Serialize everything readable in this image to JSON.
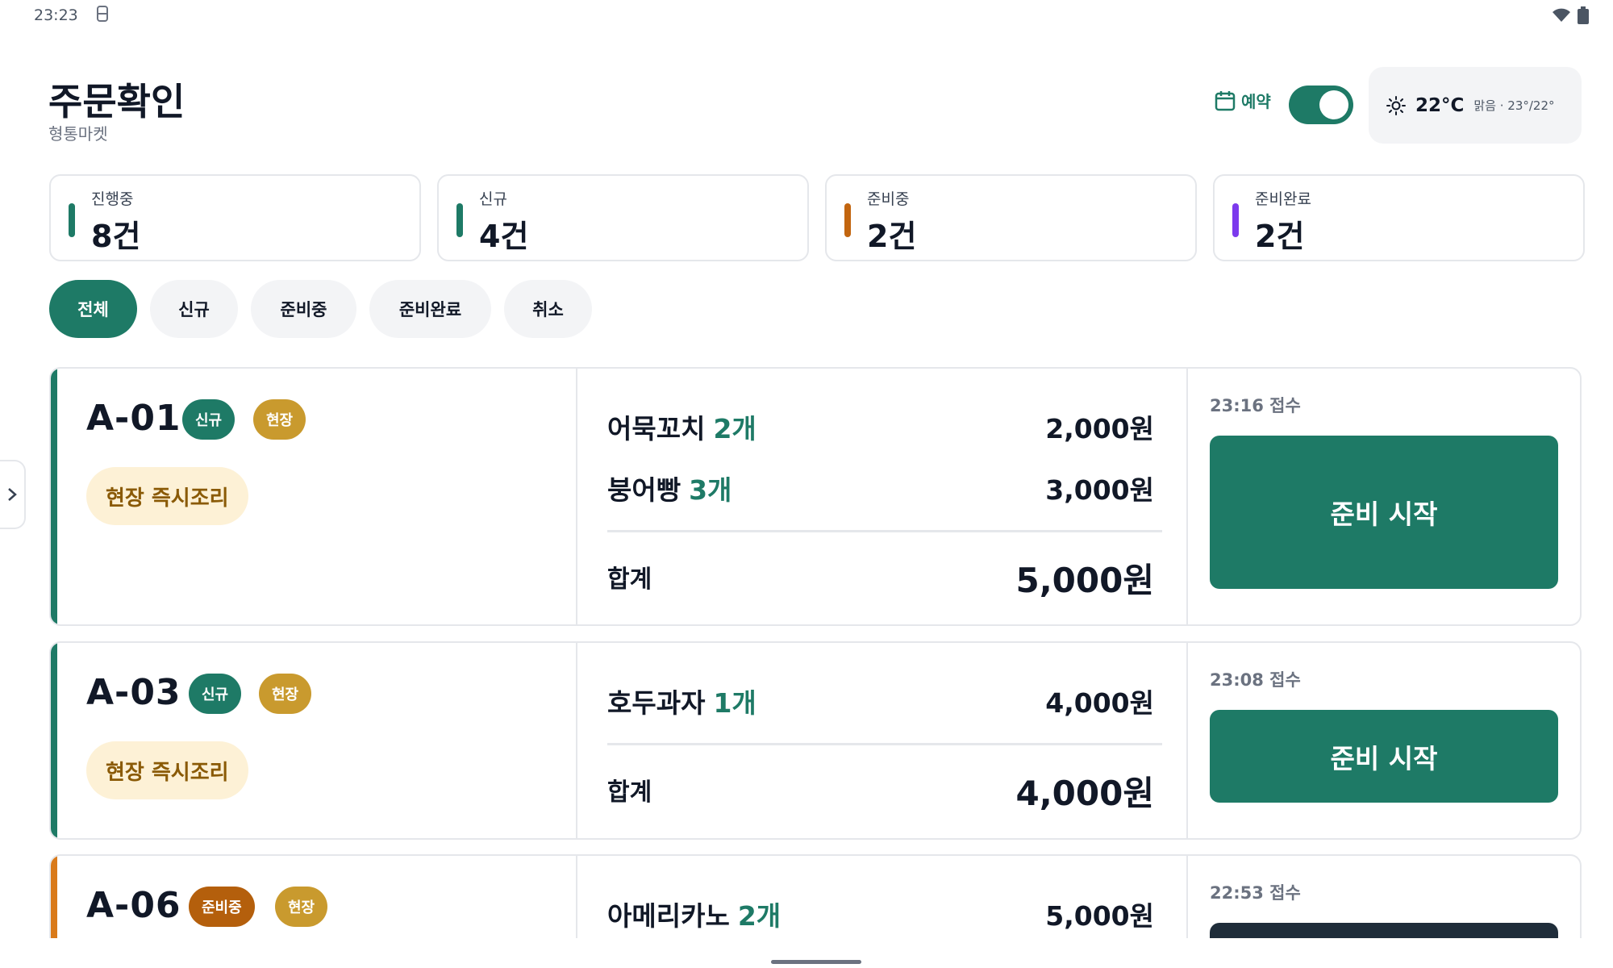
{
  "status_bar": {
    "time": "23:23"
  },
  "header": {
    "title": "주문확인",
    "subtitle": "형통마켓",
    "reserve_label": "예약",
    "reserve_on": true,
    "weather": {
      "temp": "22°C",
      "desc": "맑음 · 23°/22°"
    }
  },
  "summary": [
    {
      "label": "진행중",
      "value": "8건",
      "color": "#1e7a66"
    },
    {
      "label": "신규",
      "value": "4건",
      "color": "#1e7a66"
    },
    {
      "label": "준비중",
      "value": "2건",
      "color": "#c2650f"
    },
    {
      "label": "준비완료",
      "value": "2건",
      "color": "#7c3aed"
    }
  ],
  "tabs": [
    {
      "label": "전체",
      "active": true
    },
    {
      "label": "신규",
      "active": false
    },
    {
      "label": "준비중",
      "active": false
    },
    {
      "label": "준비완료",
      "active": false
    },
    {
      "label": "취소",
      "active": false
    }
  ],
  "orders": [
    {
      "no": "A-01",
      "status_badge": "신규",
      "type_badge": "현장",
      "note": "현장 즉시조리",
      "items": [
        {
          "name": "어묵꼬치",
          "qty": "2개",
          "price": "2,000원"
        },
        {
          "name": "붕어빵",
          "qty": "3개",
          "price": "3,000원"
        }
      ],
      "sum_label": "합계",
      "sum": "5,000원",
      "received": "23:16 접수",
      "action": "준비 시작"
    },
    {
      "no": "A-03",
      "status_badge": "신규",
      "type_badge": "현장",
      "note": "현장 즉시조리",
      "items": [
        {
          "name": "호두과자",
          "qty": "1개",
          "price": "4,000원"
        }
      ],
      "sum_label": "합계",
      "sum": "4,000원",
      "received": "23:08 접수",
      "action": "준비 시작"
    },
    {
      "no": "A-06",
      "status_badge": "준비중",
      "type_badge": "현장",
      "items": [
        {
          "name": "아메리카노",
          "qty": "2개",
          "price": "5,000원"
        }
      ],
      "received": "22:53 접수"
    }
  ],
  "colors": {
    "primary": "#1e7a66",
    "badge_type": "#c99a2e",
    "badge_preparing": "#b45f0c",
    "accent_preparing": "#d97a1a"
  }
}
